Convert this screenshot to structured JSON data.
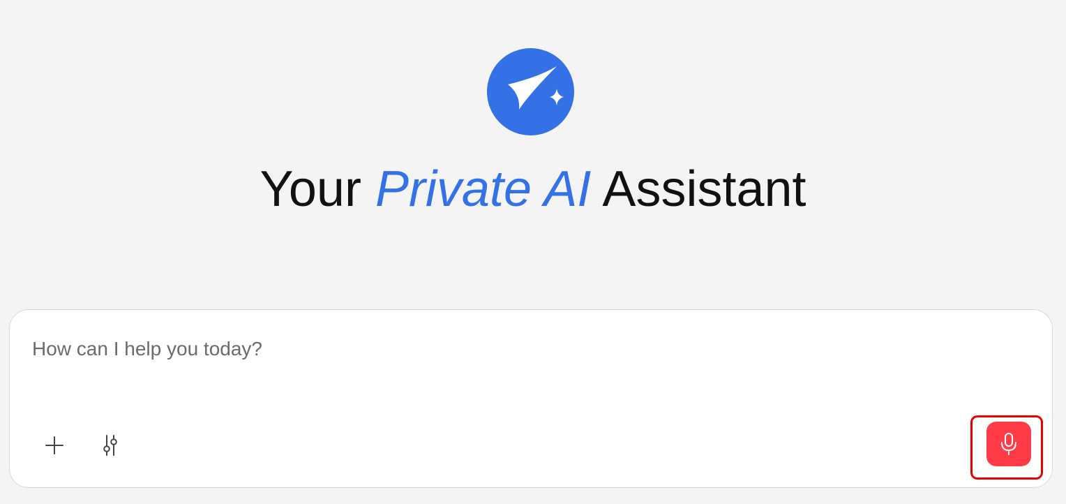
{
  "header": {
    "title_prefix": "Your",
    "title_accent": "Private AI",
    "title_suffix": "Assistant",
    "logo_icon": "sparkle-logo-icon"
  },
  "composer": {
    "placeholder": "How can I help you today?",
    "value": "",
    "add_icon": "plus-icon",
    "settings_icon": "sliders-icon",
    "mic_icon": "microphone-icon"
  },
  "colors": {
    "brand": "#3471e6",
    "mic_button": "#ff3b47",
    "highlight": "#e60000",
    "background": "#f4f4f4"
  }
}
